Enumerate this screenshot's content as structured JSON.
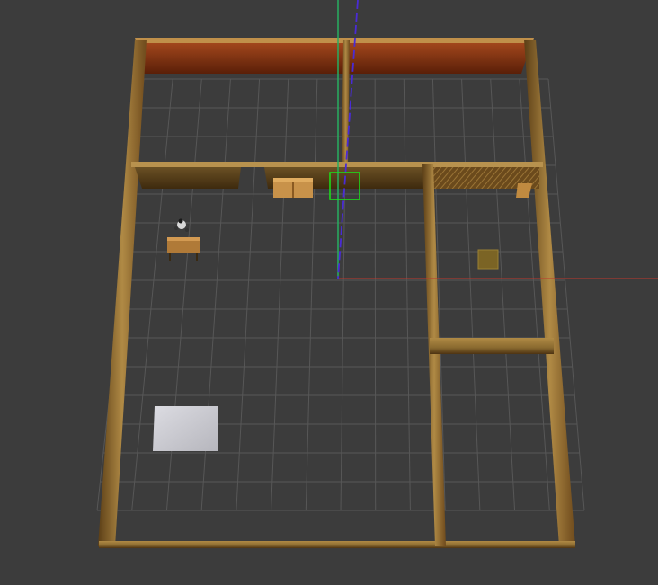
{
  "scene": {
    "background_color": "#3c3c3c",
    "grid_color": "#5a5a5a",
    "wall_color": "#8a6a30",
    "wall_dark_color": "#5b3e16",
    "wall_top_color": "#b08a45",
    "back_wall_color": "#7a2d10",
    "floor_cover_color": "#cfcfd4",
    "box_color": "#7b6425",
    "selection_color": "#19e619"
  },
  "axes": {
    "x_axis_color": "#c0392b",
    "y_axis_color": "#27ae60",
    "z_axis_color": "#4a2bd6"
  },
  "objects": {
    "robot": "robot-model",
    "table": "table-model",
    "bookshelf": "bookshelf-model",
    "door": "door-model",
    "floor_mat": "floor-mat",
    "small_box": "box-model",
    "selected": "selected-object"
  }
}
